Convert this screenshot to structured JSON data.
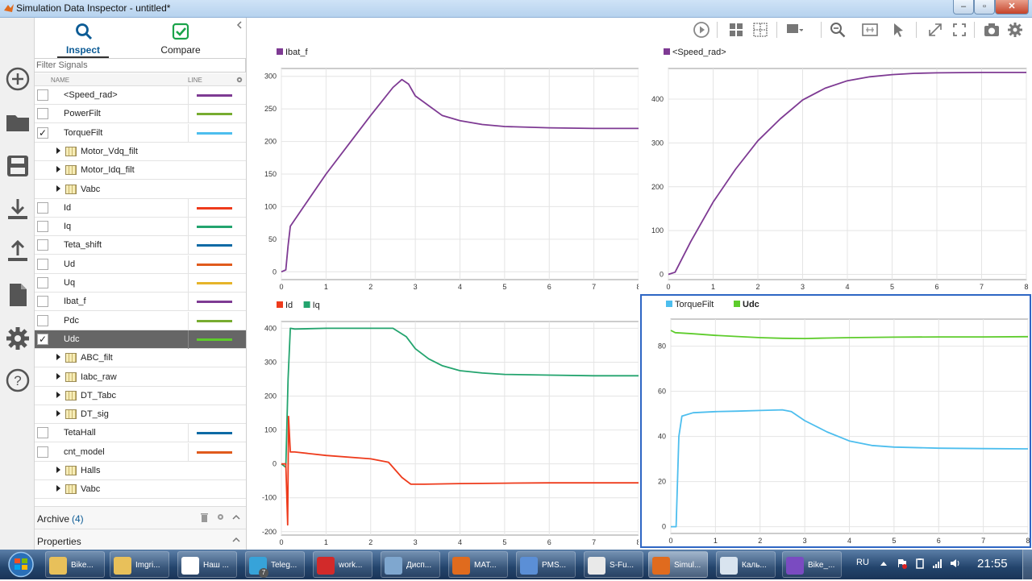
{
  "window": {
    "title": "Simulation Data Inspector - untitled*",
    "min": "–",
    "max": "▫",
    "close": "✕"
  },
  "tabs": {
    "inspect": "Inspect",
    "compare": "Compare"
  },
  "filter": {
    "placeholder": "Filter Signals"
  },
  "columns": {
    "name": "NAME",
    "line": "LINE"
  },
  "signals": [
    {
      "name": "<Speed_rad>",
      "type": "signal",
      "checked": false,
      "color": "#7e3a93"
    },
    {
      "name": "PowerFilt",
      "type": "signal",
      "checked": false,
      "color": "#77ac30"
    },
    {
      "name": "TorqueFilt",
      "type": "signal",
      "checked": true,
      "color": "#4dbeee"
    },
    {
      "name": "Motor_Vdq_filt",
      "type": "group"
    },
    {
      "name": "Motor_Idq_filt",
      "type": "group"
    },
    {
      "name": "Vabc",
      "type": "group"
    },
    {
      "name": "Id",
      "type": "signal",
      "checked": false,
      "color": "#ee3b1c"
    },
    {
      "name": "Iq",
      "type": "signal",
      "checked": false,
      "color": "#23a46e"
    },
    {
      "name": "Teta_shift",
      "type": "signal",
      "checked": false,
      "color": "#0c6aa5"
    },
    {
      "name": "Ud",
      "type": "signal",
      "checked": false,
      "color": "#e05a1c"
    },
    {
      "name": "Uq",
      "type": "signal",
      "checked": false,
      "color": "#e6b42a"
    },
    {
      "name": "Ibat_f",
      "type": "signal",
      "checked": false,
      "color": "#7e3a93"
    },
    {
      "name": "Pdc",
      "type": "signal",
      "checked": false,
      "color": "#77ac30"
    },
    {
      "name": "Udc",
      "type": "signal",
      "checked": true,
      "selected": true,
      "color": "#5ecc2c"
    },
    {
      "name": "ABC_filt",
      "type": "group"
    },
    {
      "name": "Iabc_raw",
      "type": "group"
    },
    {
      "name": "DT_Tabc",
      "type": "group"
    },
    {
      "name": "DT_sig",
      "type": "group"
    },
    {
      "name": "TetaHall",
      "type": "signal",
      "checked": false,
      "color": "#0c6aa5"
    },
    {
      "name": "cnt_model",
      "type": "signal",
      "checked": false,
      "color": "#e05a1c"
    },
    {
      "name": "Halls",
      "type": "group"
    },
    {
      "name": "Vabc",
      "type": "group"
    }
  ],
  "archive": {
    "label": "Archive",
    "count": "(4)"
  },
  "properties": {
    "label": "Properties"
  },
  "toolbar_icons": [
    "play-icon",
    "layout-grid-icon",
    "subplot-icon",
    "legend-icon",
    "zoom-in-icon",
    "fit-to-view-icon",
    "cursor-icon",
    "expand-icon",
    "fullscreen-icon",
    "snapshot-icon",
    "settings-icon"
  ],
  "left_icons": [
    "add-icon",
    "folder-icon",
    "save-icon",
    "import-icon",
    "export-icon",
    "report-icon",
    "settings-icon",
    "help-icon"
  ],
  "chart_data": [
    {
      "type": "line",
      "legend": [
        "Ibat_f"
      ],
      "xlim": [
        0,
        8
      ],
      "ylim": [
        -12,
        312
      ],
      "xticks": [
        0,
        1,
        2,
        3,
        4,
        5,
        6,
        7,
        8
      ],
      "yticks": [
        0,
        50,
        100,
        150,
        200,
        250,
        300
      ],
      "grid": true,
      "series": [
        {
          "name": "Ibat_f",
          "color": "#7e3a93",
          "x": [
            0,
            0.1,
            0.15,
            0.2,
            0.5,
            1,
            1.5,
            2,
            2.5,
            2.7,
            2.85,
            3,
            3.3,
            3.6,
            4,
            4.5,
            5,
            6,
            7,
            8
          ],
          "y": [
            0,
            3,
            40,
            70,
            100,
            150,
            195,
            240,
            283,
            295,
            288,
            270,
            255,
            240,
            232,
            226,
            223,
            221,
            220,
            220
          ]
        }
      ]
    },
    {
      "type": "line",
      "legend": [
        "<Speed_rad>"
      ],
      "xlim": [
        0,
        8
      ],
      "ylim": [
        -12,
        470
      ],
      "xticks": [
        0,
        1,
        2,
        3,
        4,
        5,
        6,
        7,
        8
      ],
      "yticks": [
        0,
        100,
        200,
        300,
        400
      ],
      "grid": true,
      "series": [
        {
          "name": "<Speed_rad>",
          "color": "#7e3a93",
          "x": [
            0,
            0.15,
            0.5,
            1,
            1.5,
            2,
            2.5,
            3,
            3.5,
            4,
            4.5,
            5,
            5.5,
            6,
            7,
            8
          ],
          "y": [
            0,
            5,
            75,
            165,
            240,
            305,
            355,
            398,
            425,
            442,
            451,
            456,
            459,
            460,
            461,
            461
          ]
        }
      ]
    },
    {
      "type": "line",
      "legend": [
        "Id",
        "Iq"
      ],
      "xlim": [
        0,
        8
      ],
      "ylim": [
        -210,
        420
      ],
      "xticks": [
        0,
        1,
        2,
        3,
        4,
        5,
        6,
        7,
        8
      ],
      "yticks": [
        -200,
        -100,
        0,
        100,
        200,
        300,
        400
      ],
      "grid": true,
      "series": [
        {
          "name": "Iq",
          "color": "#23a46e",
          "x": [
            0,
            0.1,
            0.15,
            0.2,
            0.3,
            1,
            2,
            2.5,
            2.8,
            3,
            3.3,
            3.6,
            4,
            4.5,
            5,
            6,
            7,
            8
          ],
          "y": [
            0,
            -10,
            250,
            400,
            398,
            400,
            400,
            400,
            375,
            340,
            310,
            290,
            275,
            268,
            264,
            262,
            260,
            260
          ]
        },
        {
          "name": "Id",
          "color": "#ee3b1c",
          "x": [
            0,
            0.1,
            0.14,
            0.16,
            0.2,
            0.3,
            1,
            2,
            2.4,
            2.7,
            2.9,
            3.2,
            4,
            5,
            6,
            7,
            8
          ],
          "y": [
            0,
            0,
            -180,
            140,
            35,
            35,
            25,
            15,
            5,
            -40,
            -60,
            -60,
            -58,
            -57,
            -56,
            -56,
            -56
          ]
        }
      ]
    },
    {
      "type": "line",
      "legend": [
        "TorqueFilt",
        "Udc"
      ],
      "xlim": [
        0,
        8
      ],
      "ylim": [
        -3,
        92
      ],
      "xticks": [
        0,
        1,
        2,
        3,
        4,
        5,
        6,
        7,
        8
      ],
      "yticks": [
        0,
        20,
        40,
        60,
        80
      ],
      "grid": true,
      "series": [
        {
          "name": "Udc",
          "color": "#5ecc2c",
          "x": [
            0,
            0.1,
            0.5,
            1,
            1.5,
            2,
            2.5,
            3,
            3.5,
            4,
            5,
            6,
            7,
            8
          ],
          "y": [
            87,
            86,
            85.5,
            84.8,
            84.3,
            83.8,
            83.5,
            83.4,
            83.6,
            83.8,
            84,
            84.1,
            84.1,
            84.2
          ]
        },
        {
          "name": "TorqueFilt",
          "color": "#4dbeee",
          "x": [
            0,
            0.12,
            0.18,
            0.25,
            0.5,
            1,
            1.5,
            2,
            2.5,
            2.7,
            3,
            3.5,
            4,
            4.5,
            5,
            6,
            7,
            8
          ],
          "y": [
            0,
            0,
            40,
            49,
            50.5,
            51,
            51.2,
            51.5,
            51.8,
            51,
            47,
            42,
            38,
            36,
            35.3,
            34.8,
            34.6,
            34.5
          ]
        }
      ]
    }
  ],
  "taskbar": {
    "items": [
      {
        "label": "Bike...",
        "icon": "folder-icon",
        "color": "#e8c05a"
      },
      {
        "label": "Imgri...",
        "icon": "folder-icon",
        "color": "#e8c05a"
      },
      {
        "label": "Наш ...",
        "icon": "yandex-browser-icon",
        "color": "#ffffff"
      },
      {
        "label": "Teleg...",
        "icon": "telegram-icon",
        "color": "#37a3d9"
      },
      {
        "label": "work...",
        "icon": "cube-app-icon",
        "color": "#d22a2a"
      },
      {
        "label": "Дисп...",
        "icon": "task-manager-icon",
        "color": "#7fa7cf"
      },
      {
        "label": "MAT...",
        "icon": "matlab-icon",
        "color": "#e06b1e"
      },
      {
        "label": "PMS...",
        "icon": "simulink-model-icon",
        "color": "#5b8fd6"
      },
      {
        "label": "S-Fu...",
        "icon": "s-function-icon",
        "color": "#e9e9e9"
      },
      {
        "label": "Simul...",
        "icon": "matlab-icon",
        "color": "#e06b1e",
        "active": true
      },
      {
        "label": "Каль...",
        "icon": "calculator-icon",
        "color": "#d9e4ef"
      },
      {
        "label": "Bike_...",
        "icon": "visual-studio-icon",
        "color": "#7a4bc1"
      }
    ],
    "lang": "RU",
    "time": "21:55",
    "badge": "7"
  }
}
